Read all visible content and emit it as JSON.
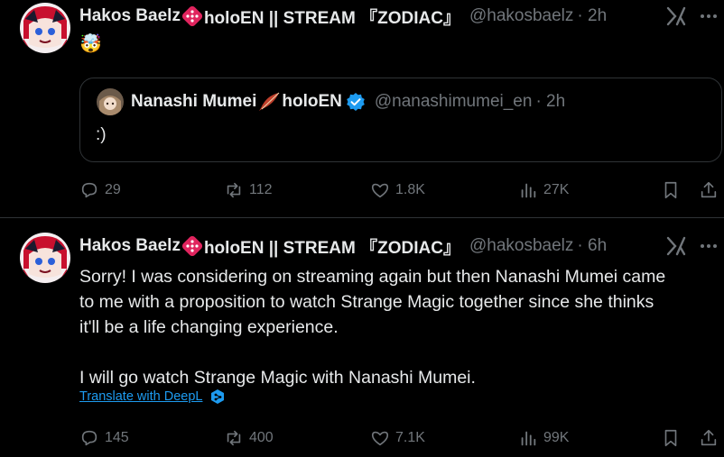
{
  "tweets": [
    {
      "author_name": "Hakos Baelz",
      "author_suffix": "holoEN || STREAM 『ZODIAC』",
      "handle": "@hakosbaelz",
      "time": "· 2h",
      "text_emoji": "🤯",
      "quote": {
        "author_name": "Nanashi Mumei",
        "author_suffix": "holoEN",
        "handle": "@nanashimumei_en",
        "time": "· 2h",
        "text": ":)"
      },
      "stats": {
        "replies": "29",
        "reposts": "112",
        "likes": "1.8K",
        "views": "27K"
      }
    },
    {
      "author_name": "Hakos Baelz",
      "author_suffix": "holoEN || STREAM 『ZODIAC』",
      "handle": "@hakosbaelz",
      "time": "· 6h",
      "text_lines": [
        "Sorry! I was considering on streaming again but then Nanashi Mumei came",
        "to me with a proposition to watch Strange Magic together since she thinks",
        "it'll be a life changing experience.",
        "I will go watch Strange Magic with Nanashi Mumei."
      ],
      "translate_label": "Translate with DeepL",
      "stats": {
        "replies": "145",
        "reposts": "400",
        "likes": "7.1K",
        "views": "99K"
      }
    }
  ],
  "colors": {
    "background": "#000000",
    "text": "#e7e9ea",
    "muted": "#71767b",
    "accent": "#1d9bf0",
    "border": "#2f3336"
  }
}
